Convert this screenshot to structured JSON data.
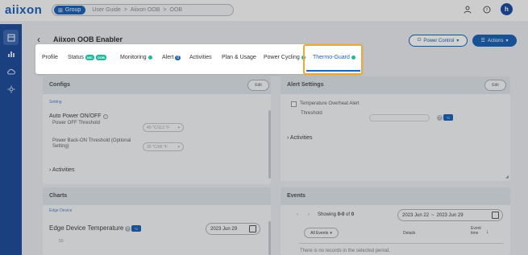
{
  "app": {
    "logo": "aiixon"
  },
  "breadcrumb": {
    "group_label": "Group",
    "items": [
      "User Guide",
      "Aiixon OOB",
      "OOB"
    ],
    "separator": ">"
  },
  "header_icons": [
    "user-icon",
    "help-icon"
  ],
  "user": {
    "initial": "h"
  },
  "sidebar": {
    "items": [
      "dashboard-icon",
      "analytics-icon",
      "cloud-icon",
      "settings-icon"
    ]
  },
  "page": {
    "title": "Aiixon OOB Enabler",
    "power_control_label": "Power Control",
    "actions_label": "Actions"
  },
  "tabs": [
    {
      "label": "Profile"
    },
    {
      "label": "Status",
      "badges": [
        "NIC",
        "OOB"
      ]
    },
    {
      "label": "Monitoring",
      "dot": true
    },
    {
      "label": "Alert",
      "count": "0"
    },
    {
      "label": "Activities"
    },
    {
      "label": "Plan & Usage"
    },
    {
      "label": "Power Cycling",
      "dot": true
    },
    {
      "label": "Thermo-Guard",
      "dot": true,
      "active": true
    }
  ],
  "configs": {
    "title": "Configs",
    "edit_label": "Edit",
    "setting_link": "Setting",
    "auto_power_label": "Auto Power ON/OFF",
    "power_off_threshold_label": "Power OFF Threshold",
    "power_off_value": "40 °C/113 °F",
    "power_back_label": "Power Back-ON Threshold (Optional Setting)",
    "power_back_value": "30 °C/86 °F",
    "activities_label": "Activities"
  },
  "alert_settings": {
    "title": "Alert Settings",
    "edit_label": "Edit",
    "overheat_label": "Temperature Overheat Alert",
    "threshold_label": "Threshold",
    "unit_toggle": "°C",
    "activities_label": "Activities"
  },
  "charts": {
    "title": "Charts",
    "edge_device_link": "Edge Device",
    "chart_title": "Edge Device Temperature",
    "unit_toggle": "°C",
    "date": "2023 Jun 29",
    "y_tick": "50"
  },
  "events": {
    "title": "Events",
    "showing_label": "Showing",
    "showing_range": "0-0",
    "of_label": "of",
    "total": "0",
    "date_from": "2023 Jun 22",
    "date_to": "2023 Jun 29",
    "date_sep": "~",
    "all_events_label": "All Events",
    "col_details": "Details",
    "col_event_time": "Event time",
    "empty_message": "There is no records in the selected period."
  },
  "colors": {
    "brand": "#1d63b8",
    "accent_orange": "#f0a92b",
    "status_green": "#1abc9c",
    "sidebar": "#214f9c"
  }
}
